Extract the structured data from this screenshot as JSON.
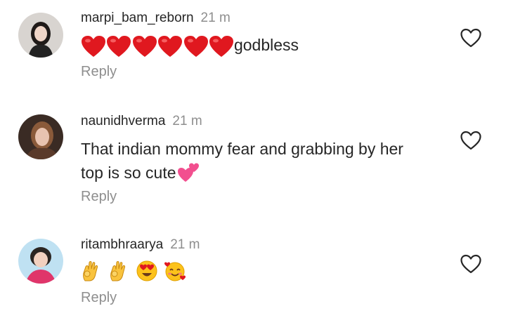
{
  "comments": [
    {
      "username": "marpi_bam_reborn",
      "time": "21 m",
      "text": "godbless",
      "reply_label": "Reply",
      "icons": [
        "red-heart-emoji",
        "red-heart-emoji",
        "red-heart-emoji",
        "red-heart-emoji",
        "red-heart-emoji",
        "red-heart-emoji"
      ]
    },
    {
      "username": "naunidhverma",
      "time": "21 m",
      "text_line1": "That indian mommy fear and grabbing by her",
      "text_line2": "top is so cute",
      "reply_label": "Reply",
      "icons": [
        "two-hearts-emoji"
      ]
    },
    {
      "username": "ritambhraarya",
      "time": "21 m",
      "reply_label": "Reply",
      "icons": [
        "ok-hand-emoji",
        "ok-hand-emoji",
        "heart-eyes-emoji",
        "smiling-face-with-hearts-emoji"
      ]
    }
  ],
  "colors": {
    "text": "#262626",
    "secondary": "#8e8e8e",
    "heart_red": "#e0181f",
    "pink": "#f24f8f"
  }
}
